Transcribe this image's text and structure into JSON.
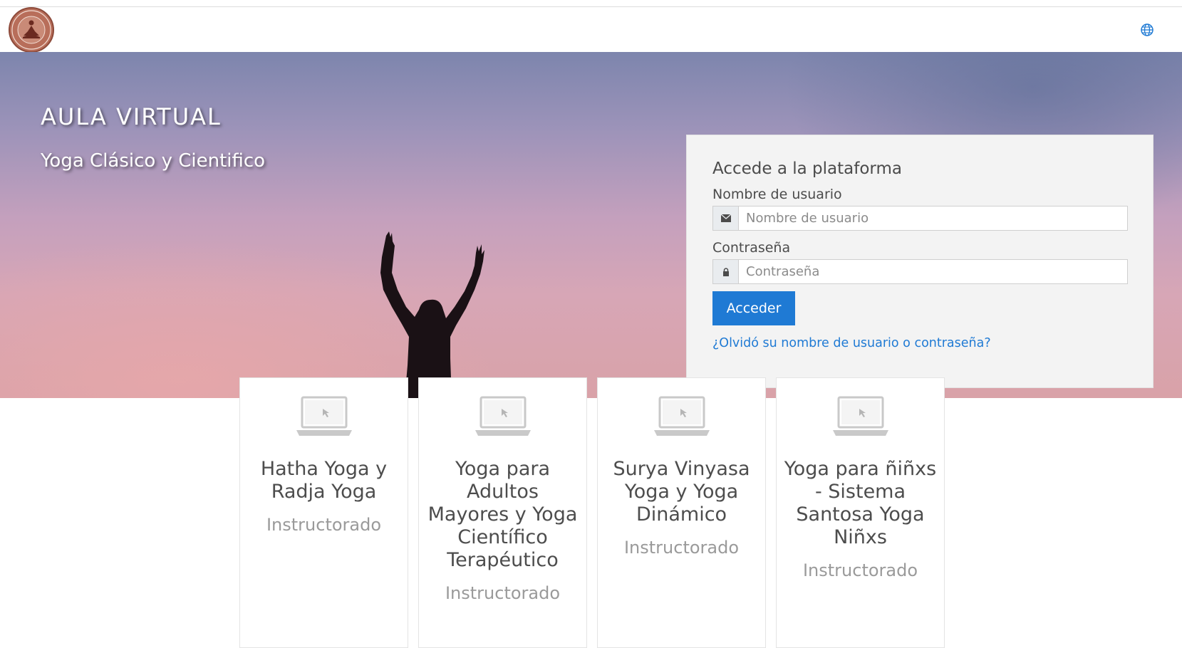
{
  "hero": {
    "title": "AULA VIRTUAL",
    "subtitle": "Yoga Clásico y Cientifico"
  },
  "login": {
    "heading": "Accede a la plataforma",
    "username_label": "Nombre de usuario",
    "username_placeholder": "Nombre de usuario",
    "password_label": "Contraseña",
    "password_placeholder": "Contraseña",
    "submit_label": "Acceder",
    "forgot_link": "¿Olvidó su nombre de usuario o contraseña?"
  },
  "courses": [
    {
      "title": "Hatha Yoga y Radja Yoga",
      "subtitle": "Instructorado"
    },
    {
      "title": "Yoga para Adultos Mayores y Yoga Científico Terapéutico",
      "subtitle": "Instructorado"
    },
    {
      "title": "Surya Vinyasa Yoga y Yoga Dinámico",
      "subtitle": "Instructorado"
    },
    {
      "title": "Yoga para ñiñxs - Sistema Santosa Yoga Niñxs",
      "subtitle": "Instructorado"
    }
  ],
  "icons": {
    "logo": "yoga-meditation-logo",
    "language": "globe-icon",
    "username": "envelope-icon",
    "password": "lock-icon",
    "course": "laptop-icon"
  },
  "colors": {
    "accent": "#1f7ad4",
    "login_panel": "#f3f3f3"
  }
}
